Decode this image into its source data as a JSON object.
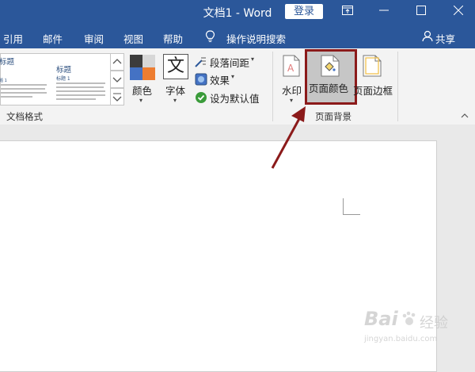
{
  "window": {
    "title": "文档1 - Word",
    "login_label": "登录",
    "colors": {
      "brand": "#2b579a",
      "highlight_box": "#8b1a1a",
      "arrow": "#8b1a1a"
    }
  },
  "tabs": [
    {
      "label": "引用"
    },
    {
      "label": "邮件"
    },
    {
      "label": "审阅"
    },
    {
      "label": "视图"
    },
    {
      "label": "帮助"
    }
  ],
  "tell_me": {
    "label": "操作说明搜索",
    "icon": "lightbulb-icon"
  },
  "share": {
    "label": "共享",
    "icon": "person-icon"
  },
  "styles_gallery": {
    "items": [
      {
        "title": "标题",
        "subtitle": "题 1"
      },
      {
        "title": "标题",
        "subtitle": "标题 1"
      }
    ],
    "group_label": "文档格式"
  },
  "design_buttons": {
    "colors": "颜色",
    "fonts": "字体",
    "fonts_glyph": "文",
    "paragraph_spacing": "段落间距",
    "effects": "效果",
    "set_default": "设为默认值"
  },
  "page_background": {
    "group_label": "页面背景",
    "watermark": "水印",
    "page_color": "页面颜色",
    "page_borders": "页面边框"
  },
  "watermark_site": {
    "brand": "Bai",
    "brand2": "经验",
    "url": "jingyan.baidu.com"
  }
}
